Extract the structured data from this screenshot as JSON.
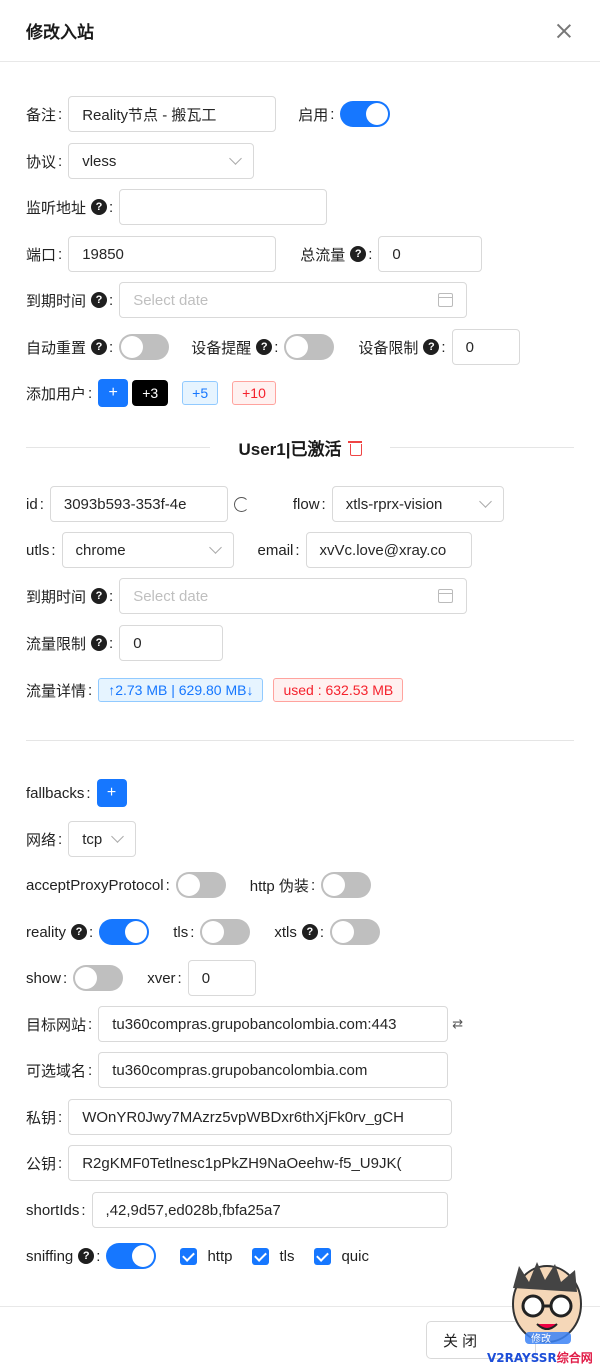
{
  "header": {
    "title": "修改入站"
  },
  "form": {
    "remark": {
      "label": "备注",
      "value": "Reality节点 - 搬瓦工"
    },
    "enable": {
      "label": "启用"
    },
    "protocol": {
      "label": "协议",
      "value": "vless"
    },
    "listen": {
      "label": "监听地址",
      "value": ""
    },
    "port": {
      "label": "端口",
      "value": "19850"
    },
    "total": {
      "label": "总流量",
      "value": "0"
    },
    "expiry": {
      "label": "到期时间",
      "placeholder": "Select date"
    },
    "auto_reset": {
      "label": "自动重置"
    },
    "device_alert": {
      "label": "设备提醒"
    },
    "device_limit": {
      "label": "设备限制",
      "value": "0"
    },
    "add_user": {
      "label": "添加用户",
      "plus": "+",
      "b3": "+3",
      "b5": "+5",
      "b10": "+10"
    }
  },
  "user": {
    "title": "User1|已激活",
    "id": {
      "label": "id",
      "value": "3093b593-353f-4e"
    },
    "flow": {
      "label": "flow",
      "value": "xtls-rprx-vision"
    },
    "utls": {
      "label": "utls",
      "value": "chrome"
    },
    "email": {
      "label": "email",
      "value": "xvVc.love@xray.co"
    },
    "expiry": {
      "label": "到期时间",
      "placeholder": "Select date"
    },
    "limit": {
      "label": "流量限制",
      "value": "0"
    },
    "traffic": {
      "label": "流量详情",
      "updown": "↑2.73 MB | 629.80 MB↓",
      "used": "used : 632.53 MB"
    }
  },
  "stream": {
    "fallbacks": {
      "label": "fallbacks",
      "plus": "+"
    },
    "network": {
      "label": "网络",
      "value": "tcp"
    },
    "accept_proxy": {
      "label": "acceptProxyProtocol"
    },
    "http_camo": {
      "label": "http 伪装"
    },
    "reality": {
      "label": "reality"
    },
    "tls": {
      "label": "tls"
    },
    "xtls": {
      "label": "xtls"
    },
    "show": {
      "label": "show"
    },
    "xver": {
      "label": "xver",
      "value": "0"
    },
    "dest": {
      "label": "目标网站",
      "value": "tu360compras.grupobancolombia.com:443"
    },
    "server_names": {
      "label": "可选域名",
      "value": "tu360compras.grupobancolombia.com"
    },
    "private_key": {
      "label": "私钥",
      "value": "WOnYR0Jwy7MAzrz5vpWBDxr6thXjFk0rv_gCH"
    },
    "public_key": {
      "label": "公钥",
      "value": "R2gKMF0Tetlnesc1pPkZH9NaOeehw-f5_U9JK("
    },
    "short_ids": {
      "label": "shortIds",
      "value": ",42,9d57,ed028b,fbfa25a7"
    },
    "sniffing": {
      "label": "sniffing",
      "http": "http",
      "tls": "tls",
      "quic": "quic"
    }
  },
  "footer": {
    "close_label": "关 闭"
  },
  "watermark": {
    "text": "V2RAYSSR综合网",
    "overlay": "修改"
  },
  "colors": {
    "primary": "#1677ff",
    "danger": "#f5222d"
  }
}
